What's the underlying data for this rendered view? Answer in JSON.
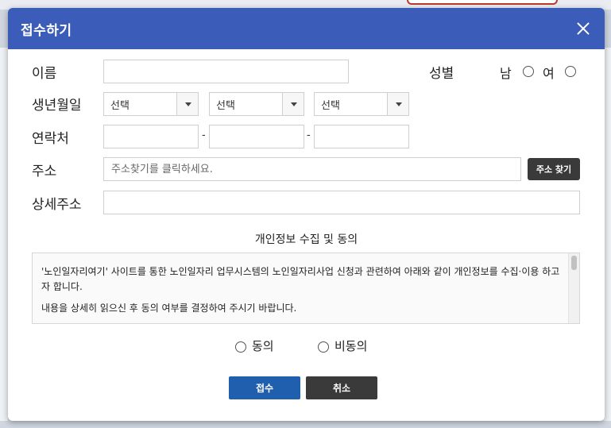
{
  "dialog": {
    "title": "접수하기"
  },
  "form": {
    "name_label": "이름",
    "gender_label": "성별",
    "gender_male": "남",
    "gender_female": "여",
    "birth_label": "생년월일",
    "birth_year": "선택",
    "birth_month": "선택",
    "birth_day": "선택",
    "contact_label": "연락처",
    "contact_separator": "-",
    "address_label": "주소",
    "address_placeholder": "주소찾기를 클릭하세요.",
    "address_search_button": "주소 찾기",
    "detail_address_label": "상세주소"
  },
  "privacy": {
    "title": "개인정보 수집 및 동의",
    "paragraphs": [
      "'노인일자리여기' 사이트를 통한 노인일자리 업무시스템의 노인일자리사업 신청과 관련하여 아래와 같이 개인정보를 수집·이용 하고자 합니다.",
      "내용을 상세히 읽으신 후 동의 여부를 결정하여 주시기 바랍니다."
    ],
    "agree_label": "동의",
    "disagree_label": "비동의"
  },
  "actions": {
    "submit": "접수",
    "cancel": "취소"
  }
}
